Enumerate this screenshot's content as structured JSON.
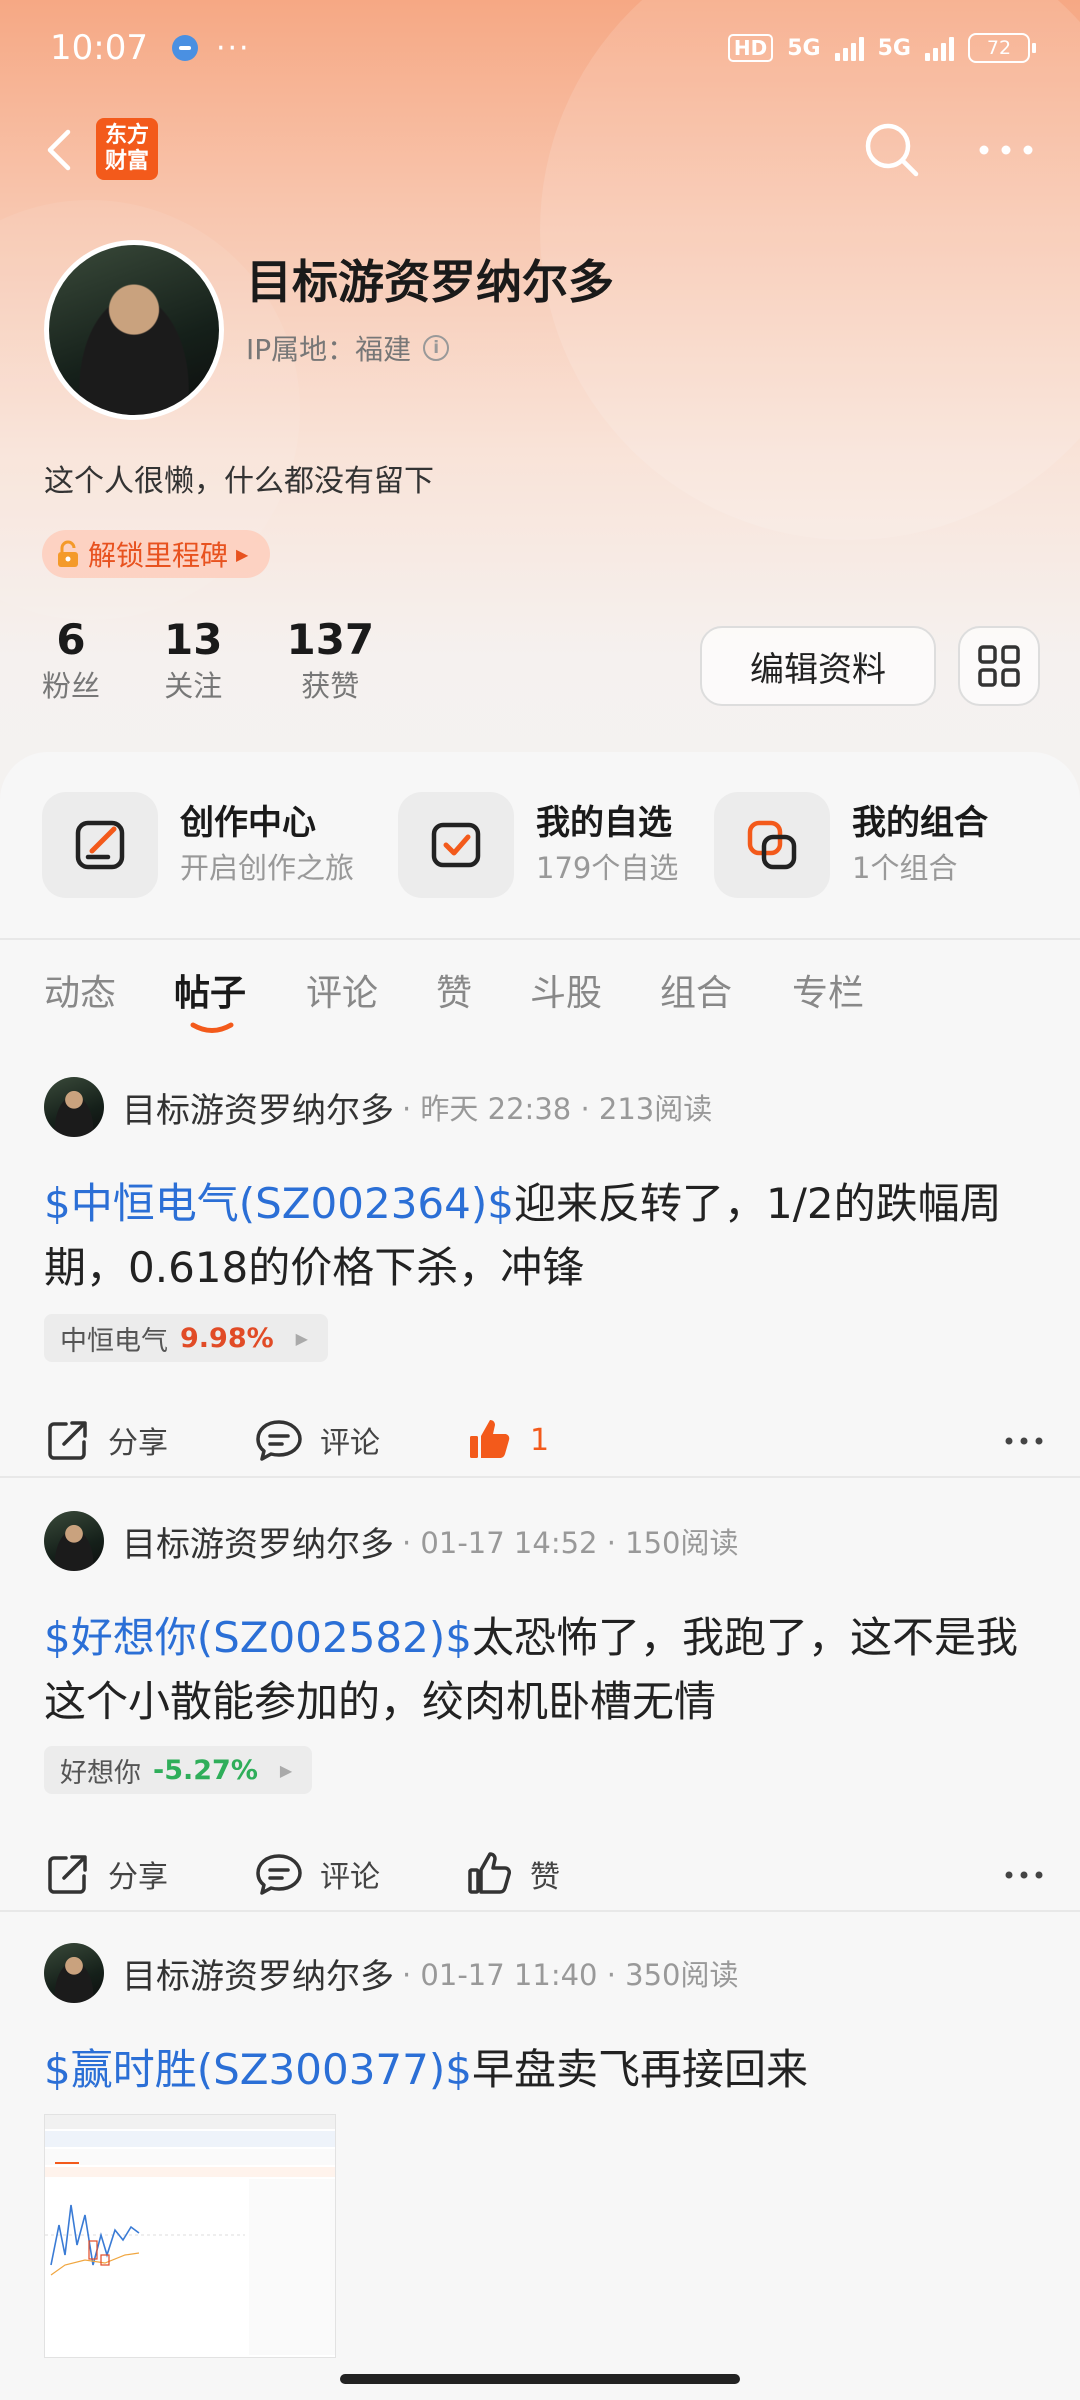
{
  "status_bar": {
    "time": "10:07",
    "more": "···",
    "hd": "HD",
    "net1": "5G",
    "net2": "5G",
    "battery": "72"
  },
  "nav": {
    "logo_line1": "东方",
    "logo_line2": "财富"
  },
  "profile": {
    "username": "目标游资罗纳尔多",
    "ip_location": "IP属地：福建",
    "bio": "这个人很懒，什么都没有留下",
    "milestone": "解锁里程碑",
    "stats": [
      {
        "num": "6",
        "label": "粉丝"
      },
      {
        "num": "13",
        "label": "关注"
      },
      {
        "num": "137",
        "label": "获赞"
      }
    ],
    "edit_button": "编辑资料"
  },
  "shortcuts": [
    {
      "title": "创作中心",
      "sub": "开启创作之旅",
      "icon": "edit-icon"
    },
    {
      "title": "我的自选",
      "sub": "179个自选",
      "icon": "checkbox-icon"
    },
    {
      "title": "我的组合",
      "sub": "1个组合",
      "icon": "portfolio-icon"
    }
  ],
  "tabs": [
    "动态",
    "帖子",
    "评论",
    "赞",
    "斗股",
    "组合",
    "专栏"
  ],
  "active_tab": "帖子",
  "posts": [
    {
      "author": "目标游资罗纳尔多",
      "meta": "· 昨天 22:38 · 213阅读",
      "stock_link": "$中恒电气(SZ002364)$",
      "text": "迎来反转了，1/2的跌幅周期，0.618的价格下杀，冲锋",
      "chip_name": "中恒电气",
      "chip_pct": "9.98%",
      "chip_color": "#e14b26",
      "share": "分享",
      "comment": "评论",
      "like": "1",
      "liked": true
    },
    {
      "author": "目标游资罗纳尔多",
      "meta": "· 01-17 14:52 · 150阅读",
      "stock_link": "$好想你(SZ002582)$",
      "text": "太恐怖了，我跑了，这不是我这个小散能参加的，绞肉机卧槽无情",
      "chip_name": "好想你",
      "chip_pct": "-5.27%",
      "chip_color": "#2fae5a",
      "share": "分享",
      "comment": "评论",
      "like": "赞",
      "liked": false
    },
    {
      "author": "目标游资罗纳尔多",
      "meta": "· 01-17 11:40 · 350阅读",
      "stock_link": "$赢时胜(SZ300377)$",
      "text": "早盘卖飞再接回来"
    }
  ],
  "colors": {
    "accent": "#f35a1b",
    "link": "#2b6fd6",
    "up": "#e14b26",
    "down": "#2fae5a"
  }
}
